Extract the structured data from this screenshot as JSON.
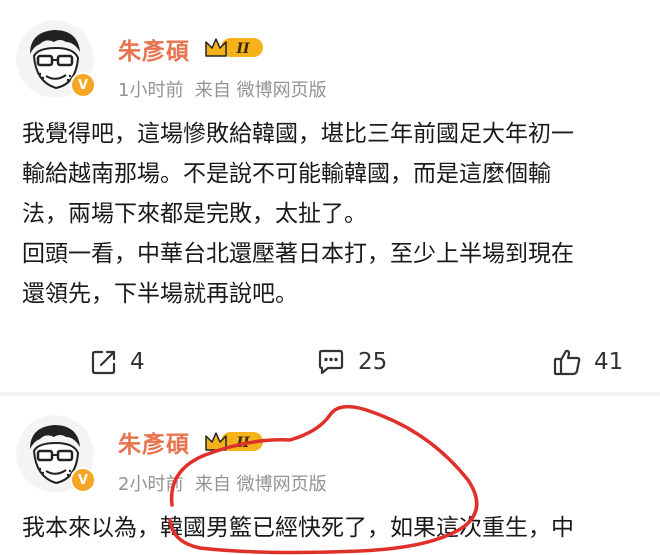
{
  "posts": [
    {
      "author": "朱彥碩",
      "level_badge": "II",
      "verified_badge": "V",
      "time": "1小时前",
      "source": "来自 微博网页版",
      "body_lines": [
        "我覺得吧，這場慘敗給韓國，堪比三年前國足大年初一",
        "輸給越南那場。不是說不可能輸韓國，而是這麼個輸",
        "法，兩場下來都是完敗，太扯了。",
        "回頭一看，中華台北還壓著日本打，至少上半場到現在",
        "還領先，下半場就再說吧。"
      ],
      "actions": {
        "repost_count": "4",
        "comment_count": "25",
        "like_count": "41"
      }
    },
    {
      "author": "朱彥碩",
      "level_badge": "II",
      "verified_badge": "V",
      "time": "2小时前",
      "source": "来自 微博网页版",
      "body_lines": [
        "我本來以為，韓國男籃已經快死了，如果這次重生，中"
      ]
    }
  ],
  "icons": {
    "repost": "share-edit-icon",
    "comment": "comment-icon",
    "like": "thumbs-up-icon"
  },
  "colors": {
    "author_name": "#e8734f",
    "meta": "#939393",
    "verified": "#f6a623",
    "level_badge": "#f5b21b",
    "annotation_circle": "#e0302a"
  }
}
